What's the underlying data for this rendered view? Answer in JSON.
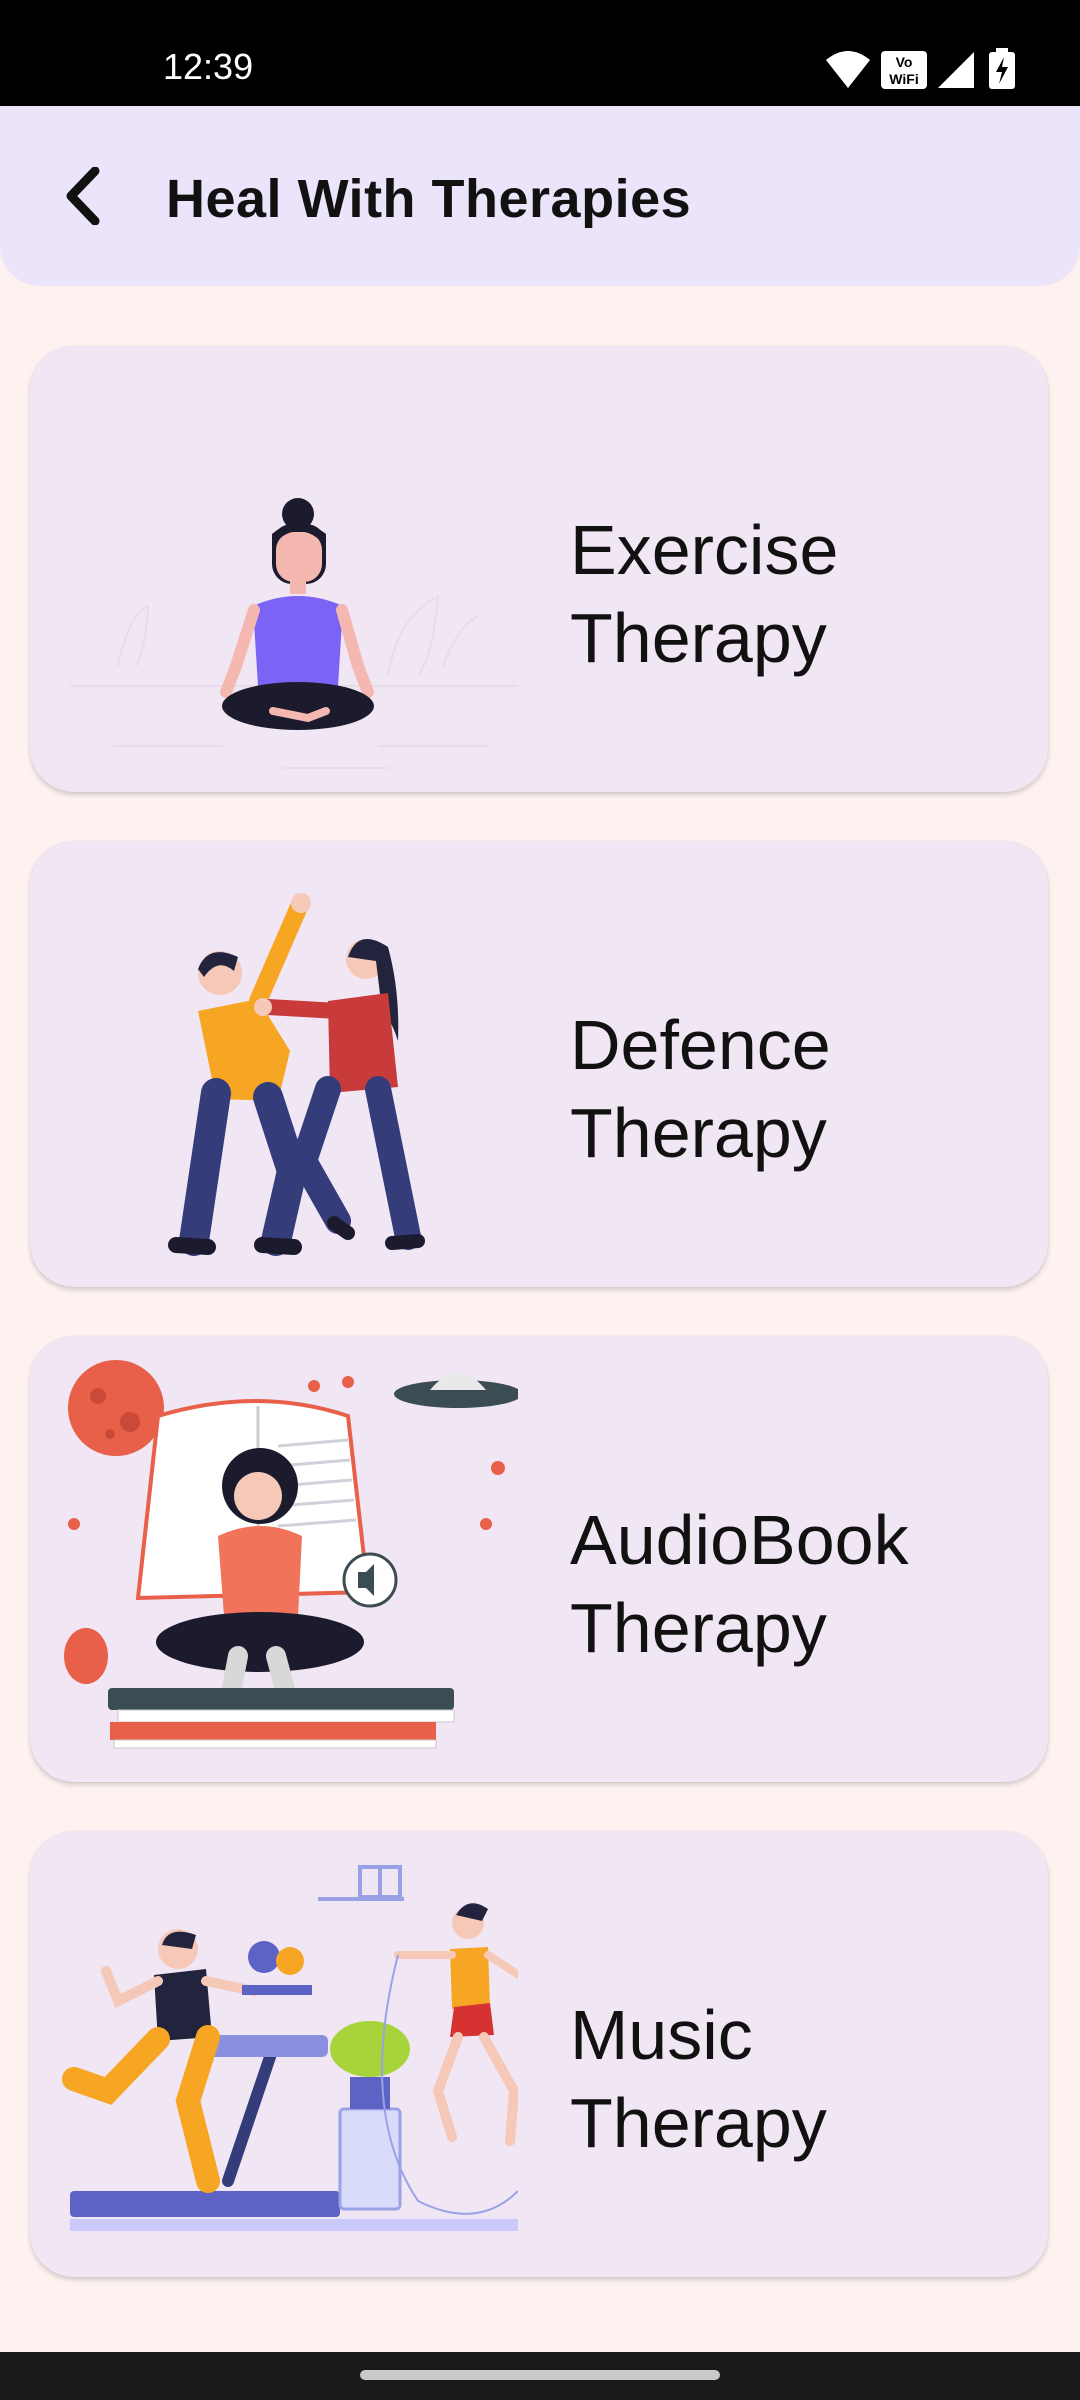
{
  "status_bar": {
    "time": "12:39",
    "icons": [
      "wifi-icon",
      "vowifi-icon",
      "signal-icon",
      "battery-charging-icon"
    ]
  },
  "app_bar": {
    "title": "Heal With Therapies",
    "back_icon": "chevron-left-icon"
  },
  "cards": [
    {
      "title": "Exercise\nTherapy",
      "illustration": "meditation-illustration"
    },
    {
      "title": "Defence\nTherapy",
      "illustration": "self-defence-illustration"
    },
    {
      "title": "AudioBook\nTherapy",
      "illustration": "audiobook-illustration"
    },
    {
      "title": "Music\nTherapy",
      "illustration": "music-workout-illustration"
    }
  ],
  "colors": {
    "background": "#fdf2f0",
    "app_bar": "#ece4fb",
    "card": "#f1e6f4",
    "text": "#111111"
  }
}
